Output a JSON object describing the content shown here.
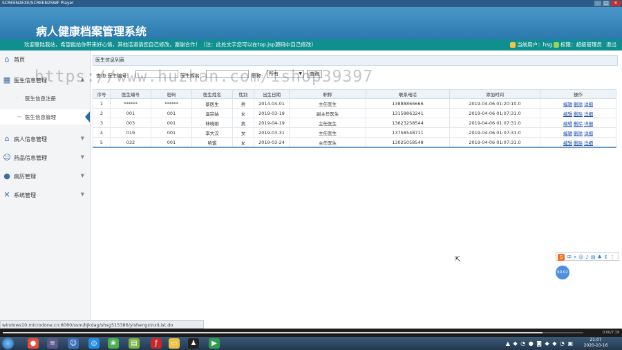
{
  "window": {
    "title": "SCREEN2EXE/SCREEN2SWF Player",
    "controls": [
      "–",
      "□",
      "✕"
    ]
  },
  "app": {
    "title": "病人健康档案管理系统"
  },
  "notice": {
    "message": "欢迎登陆我站，希望能给你带来好心情，其他话语请您自己修改，谢谢合作！（注：此处文字您可以在top.jsp源码中自己修改）",
    "user_label": "当前用户：hsg",
    "role_label": "权限：超级管理员",
    "logout": "退出"
  },
  "sidebar": {
    "home": {
      "label": "首页",
      "icon": "home-icon"
    },
    "groups": [
      {
        "label": "医生信息管理",
        "icon": "grid-icon",
        "expanded": true,
        "children": [
          {
            "label": "医生信息注册",
            "active": false
          },
          {
            "label": "医生信息管理",
            "active": true
          }
        ]
      },
      {
        "label": "病人信息管理",
        "icon": "house-icon"
      },
      {
        "label": "药品信息管理",
        "icon": "users-icon"
      },
      {
        "label": "病历管理",
        "icon": "person-icon"
      },
      {
        "label": "系统管理",
        "icon": "tools-icon"
      }
    ]
  },
  "panel": {
    "title": "医生信息列表"
  },
  "search": {
    "id_label": "查询:医生编号:",
    "name_label": "医生姓名:",
    "title_label": "职称:",
    "title_select": "所有",
    "button": "查询"
  },
  "table": {
    "headers": [
      "序号",
      "医生编号",
      "密码",
      "医生姓名",
      "性别",
      "出生日期",
      "职称",
      "联系电话",
      "添加时间",
      "操作"
    ],
    "ops": [
      "编辑",
      "删除",
      "详细"
    ],
    "rows": [
      [
        "1",
        "******",
        "******",
        "蔡医生",
        "男",
        "2014-04-01",
        "主任医生",
        "13888866666",
        "2019-04-06 01:20:10.0"
      ],
      [
        "2",
        "001",
        "001",
        "温宗姑",
        "女",
        "2019-03-19",
        "副主任医生",
        "13158863241",
        "2019-04-06 01:07:31.0"
      ],
      [
        "3",
        "003",
        "001",
        "林晓刚",
        "男",
        "2019-04-19",
        "主任医生",
        "13623258544",
        "2019-04-06 01:07:31.0"
      ],
      [
        "4",
        "019",
        "001",
        "李大汉",
        "女",
        "2019-03-31",
        "主任医生",
        "13758548711",
        "2019-04-06 01:07:31.0"
      ],
      [
        "5",
        "032",
        "001",
        "哈盟",
        "女",
        "2019-03-24",
        "主任医生",
        "13025058548",
        "2019-04-06 01:07:31.0"
      ]
    ]
  },
  "statusbar": {
    "url": "windows10.microdone.cn:8080/ssm/bjkdag/shsg515386/yishengxinxiList.do"
  },
  "player": {
    "time": "0:00/7:19",
    "progress": 0.93
  },
  "taskbar": {
    "clock_time": "21:07",
    "clock_date": "2020-10-16",
    "tray": "▲ ◆ ◔ ● ◙ ◆ ◆ ◔ ▣"
  },
  "ime": {
    "badge": "S",
    "items": [
      "中",
      "•",
      "☺",
      "♪",
      "▤",
      "♣",
      "↕",
      "⋮"
    ]
  },
  "float_ball": "80.02",
  "watermark": "https://www.huzhan.com/ishop39397"
}
